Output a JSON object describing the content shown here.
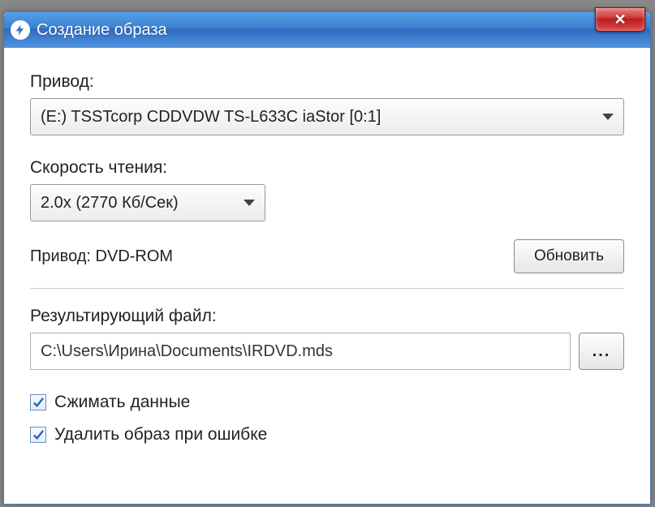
{
  "titlebar": {
    "title": "Создание образа",
    "close_symbol": "✕"
  },
  "drive": {
    "label": "Привод:",
    "value": "(E:) TSSTcorp CDDVDW TS-L633C iaStor [0:1]"
  },
  "speed": {
    "label": "Скорость чтения:",
    "value": "2.0x (2770 Кб/Сек)"
  },
  "drive_info": {
    "text": "Привод: DVD-ROM",
    "refresh_label": "Обновить"
  },
  "output": {
    "label": "Результирующий файл:",
    "path": "C:\\Users\\Ирина\\Documents\\IRDVD.mds",
    "browse_label": "..."
  },
  "checks": {
    "compress": "Сжимать данные",
    "delete_on_error": "Удалить образ при ошибке"
  }
}
